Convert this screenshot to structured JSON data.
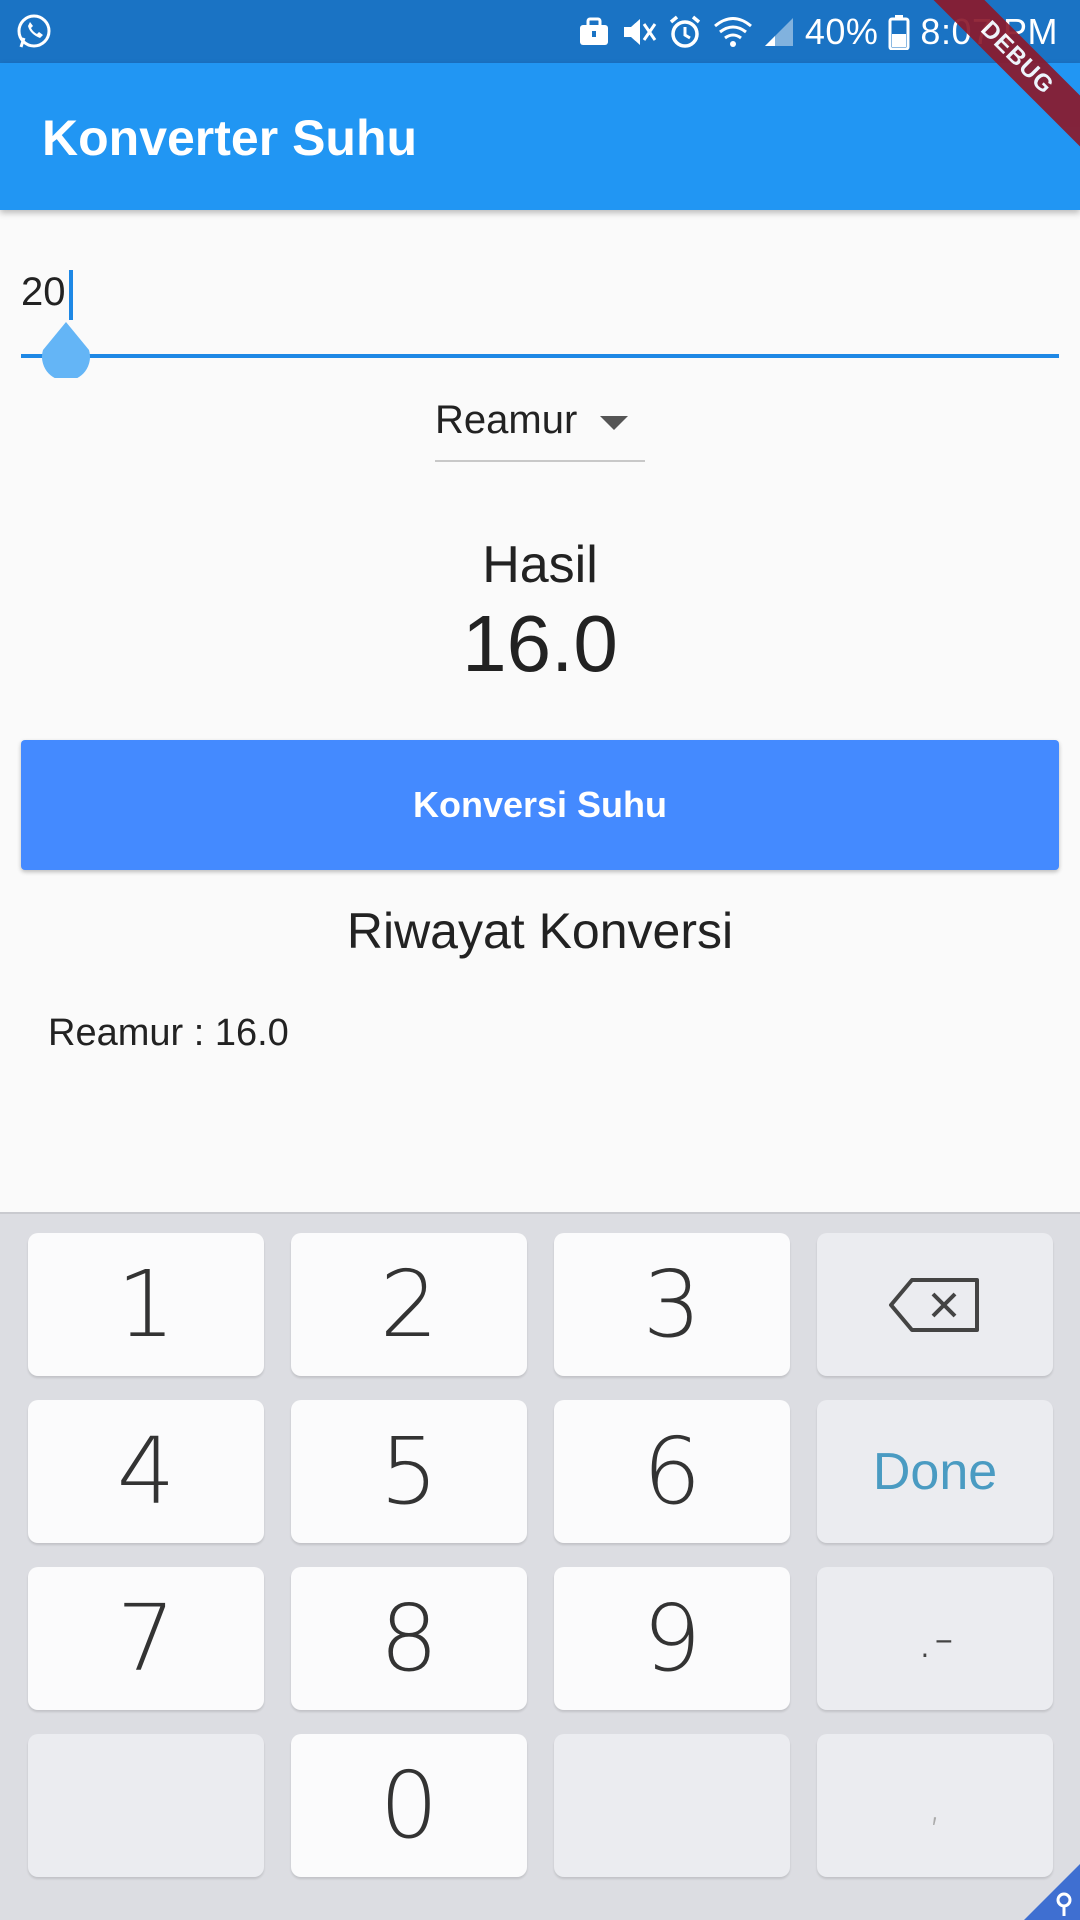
{
  "status_bar": {
    "battery_percent": "40%",
    "time": "8:07 PM",
    "icons": [
      "whatsapp-icon",
      "briefcase-icon",
      "mute-icon",
      "alarm-icon",
      "wifi-icon",
      "signal-icon",
      "battery-icon"
    ]
  },
  "debug_banner": "DEBUG",
  "app_bar": {
    "title": "Konverter Suhu"
  },
  "input": {
    "value": "20"
  },
  "dropdown": {
    "selected": "Reamur"
  },
  "result": {
    "label": "Hasil",
    "value": "16.0"
  },
  "convert_button": {
    "label": "Konversi Suhu"
  },
  "history": {
    "title": "Riwayat Konversi",
    "items": [
      "Reamur : 16.0"
    ]
  },
  "keyboard": {
    "keys": [
      "1",
      "2",
      "3",
      "4",
      "5",
      "6",
      "7",
      "8",
      "9",
      "0"
    ],
    "done_label": "Done",
    "symbol_label": ".-",
    "comma_label": ","
  },
  "colors": {
    "status_bar": "#1a73c4",
    "app_bar": "#2196f3",
    "button": "#448aff",
    "accent": "#1e88e5",
    "done_text": "#4a9bc2"
  }
}
